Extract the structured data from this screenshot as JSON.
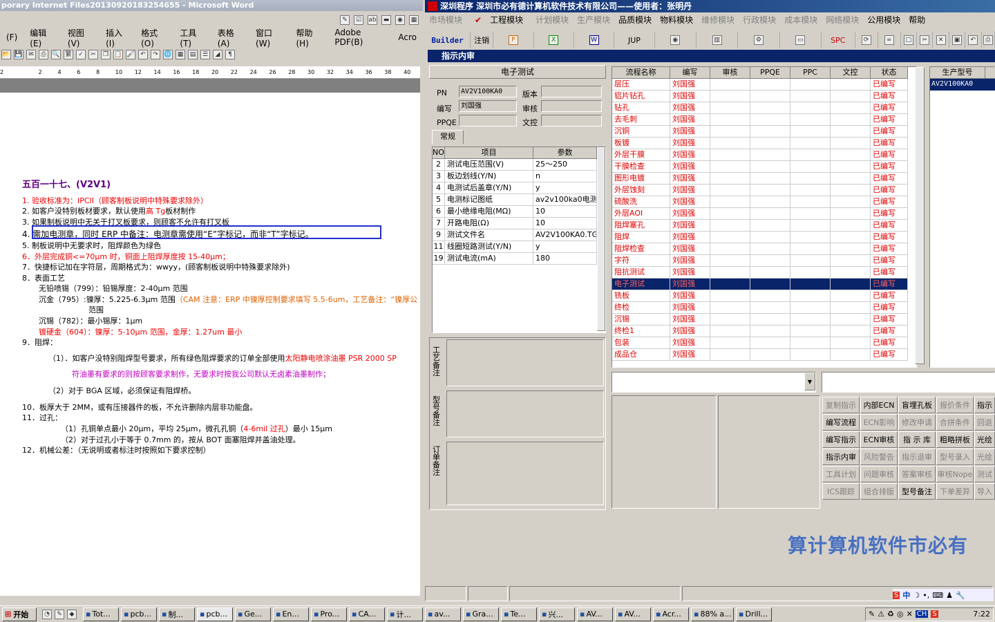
{
  "word": {
    "title": "porary Internet Files20130920183254655 - Microsoft Word",
    "menu": [
      "(F)",
      "编辑(E)",
      "视图(V)",
      "插入(I)",
      "格式(O)",
      "工具(T)",
      "表格(A)",
      "窗口(W)",
      "帮助(H)",
      "Adobe PDF(B)",
      "Acro"
    ],
    "ruler": [
      "2",
      "",
      "2",
      "4",
      "6",
      "8",
      "10",
      "12",
      "14",
      "16",
      "18",
      "20",
      "22",
      "24",
      "26",
      "28",
      "30",
      "32",
      "34",
      "36",
      "38",
      "40"
    ],
    "heading": "五百一十七、(V2V1)",
    "l1a": "1.   验收标准为：IPCII（顾客制板说明中特殊要求除外）",
    "l2a": "2.   如客户没特别板材要求，默认使用",
    "l2b": "高 Tg",
    "l2c": "板材制作",
    "l3": "3.   如果制板说明中无关于打叉板要求，则顾客不允许有打叉板",
    "l4": "4.   需加电测章，同时 ERP 中备注：电测章需使用“E”字标记，而非“T”字标记。",
    "l5": "5.   制板说明中无要求时，阻焊颜色为绿色",
    "l6": "6．外层完成铜<=70μm 时，铜面上阻焊厚度按 15-40μm；",
    "l7": "7．快捷标记加在字符层，周期格式为：wwyy，(顾客制板说明中特殊要求除外)",
    "l8": "8．表面工艺",
    "l8a": "无铅喷锡（799）：铅锡厚度：2-40μm 范围",
    "l8b1": "沉金（795）:镍厚：5.225-6.3μm 范围",
    "l8b2": "（CAM 注意：ERP 中镍厚控制要求填写 5.5-6um，工艺备注：“镍厚公",
    "l8b3": "范围",
    "l8c": "沉锡（782）：最小锡厚：1μm",
    "l8d": "镀硬金（604）：镍厚：5-10μm 范围，金厚：1.27um 最小",
    "l9": "9．阻焊：",
    "l9a1": "（1）．如客户没特别阻焊型号要求，所有绿色阻焊要求的订单全部使用",
    "l9a2": "太阳静电喷涂油墨 PSR 2000 SP",
    "l9b": "符油墨有要求的则按顾客要求制作，无要求时按我公司默认无卤素油墨制作；",
    "l9c": "（2）对于 BGA 区域，必须保证有阻焊桥。",
    "l10": "10．板厚大于 2MM，或有压接器件的板，不允许删除内层非功能盘。",
    "l11": "11．过孔：",
    "l11a1": "（1）孔铜单点最小 20μm，平均 25μm，微孔孔铜（",
    "l11a2": "4-6mil 过孔",
    "l11a3": "）最小 15μm",
    "l11b": "（2）对于过孔小于等于 0.7mm 的，按从 BOT 面塞阻焊并盖油处理。",
    "l12": "12．机械公差：（无说明或者标注时按照如下要求控制）"
  },
  "app": {
    "title": "深圳程序   深圳市必有德计算机软件技术有限公司——使用者：张明丹",
    "menu": [
      "市场模块",
      "工程模块",
      "计划模块",
      "生产模块",
      "品质模块",
      "物料模块",
      "维修模块",
      "行政模块",
      "成本模块",
      "网络模块",
      "公用模块",
      "帮助"
    ],
    "toolbar": [
      "Builder",
      "注销",
      "",
      "",
      "W",
      "JUP",
      "",
      "",
      "",
      "",
      "SPC",
      "",
      "",
      "",
      "",
      "",
      "",
      ""
    ],
    "window_title": "指示内审",
    "section": "电子测试",
    "pn_label": "PN",
    "pn": "AV2V100KA0",
    "ver_label": "版本",
    "ver": "",
    "writer_label": "编写",
    "writer": "刘国强",
    "review_label": "审核",
    "review": "",
    "ppqe_label": "PPQE",
    "ppqe": "",
    "doc_label": "文控",
    "doc": "",
    "tab": "常规",
    "param_headers": [
      "NO",
      "项目",
      "参数"
    ],
    "params": [
      [
        "2",
        "测试电压范围(V)",
        "25～250"
      ],
      [
        "3",
        "板边划线(Y/N)",
        "n"
      ],
      [
        "4",
        "电测试后盖章(Y/N)",
        "y"
      ],
      [
        "5",
        "电测标记图纸",
        "av2v100ka0电测"
      ],
      [
        "6",
        "最小绝缘电阻(MΩ)",
        "10"
      ],
      [
        "7",
        "开路电阻(Ω)",
        "10"
      ],
      [
        "9",
        "测试文件名",
        "AV2V100KA0.TGZ"
      ],
      [
        "11",
        "线圈短路测试(Y/N)",
        "y"
      ],
      [
        "19",
        "测试电流(mA)",
        "180"
      ]
    ],
    "note1": "工艺备注",
    "note2": "型号备注",
    "note3": "订单备注",
    "flow_headers": [
      "流程名称",
      "编写",
      "审核",
      "PPQE",
      "PPC",
      "文控",
      "状态"
    ],
    "flows": [
      [
        "层压",
        "刘国强",
        "已编写"
      ],
      [
        "铝片钻孔",
        "刘国强",
        "已编写"
      ],
      [
        "钻孔",
        "刘国强",
        "已编写"
      ],
      [
        "去毛刺",
        "刘国强",
        "已编写"
      ],
      [
        "沉铜",
        "刘国强",
        "已编写"
      ],
      [
        "板镀",
        "刘国强",
        "已编写"
      ],
      [
        "外层干膜",
        "刘国强",
        "已编写"
      ],
      [
        "干膜检查",
        "刘国强",
        "已编写"
      ],
      [
        "图形电镀",
        "刘国强",
        "已编写"
      ],
      [
        "外层蚀刻",
        "刘国强",
        "已编写"
      ],
      [
        "硫酸洗",
        "刘国强",
        "已编写"
      ],
      [
        "外层AOI",
        "刘国强",
        "已编写"
      ],
      [
        "阻焊塞孔",
        "刘国强",
        "已编写"
      ],
      [
        "阻焊",
        "刘国强",
        "已编写"
      ],
      [
        "阻焊检查",
        "刘国强",
        "已编写"
      ],
      [
        "字符",
        "刘国强",
        "已编写"
      ],
      [
        "阻抗测试",
        "刘国强",
        "已编写"
      ],
      [
        "电子测试",
        "刘国强",
        "已编写"
      ],
      [
        "铣板",
        "刘国强",
        "已编写"
      ],
      [
        "终检",
        "刘国强",
        "已编写"
      ],
      [
        "沉锡",
        "刘国强",
        "已编写"
      ],
      [
        "终检1",
        "刘国强",
        "已编写"
      ],
      [
        "包装",
        "刘国强",
        "已编写"
      ],
      [
        "成品仓",
        "刘国强",
        "已编写"
      ]
    ],
    "prod_header": "生产型号",
    "prod": "AV2V100KA0",
    "buttons": [
      [
        "复制指示",
        "内部ECN",
        "盲埋孔板",
        "报价条件",
        "指示"
      ],
      [
        "编写流程",
        "ECN影响",
        "修改申请",
        "合拼条件",
        "回退"
      ],
      [
        "编写指示",
        "ECN审核",
        "指 示 库",
        "粗略拼板",
        "光绘"
      ],
      [
        "指示内审",
        "风险警告",
        "指示退审",
        "型号录入",
        "光绘"
      ],
      [
        "工具计划",
        "问题审核",
        "答案审核",
        "审核Nope",
        "测试"
      ],
      [
        "ICS跟踪",
        "组合排版",
        "型号备注",
        "下单差异",
        "导入"
      ]
    ],
    "watermark": "算计算机软件市必有"
  },
  "taskbar": {
    "start": "开始",
    "tasks": [
      "Tot...",
      "pcb...",
      "制...",
      "pcb...",
      "Ge...",
      "En...",
      "Pro...",
      "CA...",
      "计...",
      "av...",
      "Gra...",
      "Te...",
      "兴...",
      "AV...",
      "AV...",
      "Acr...",
      "88% a...",
      "Drill..."
    ],
    "ime": "中",
    "lang": "CH",
    "time": "7:22"
  }
}
